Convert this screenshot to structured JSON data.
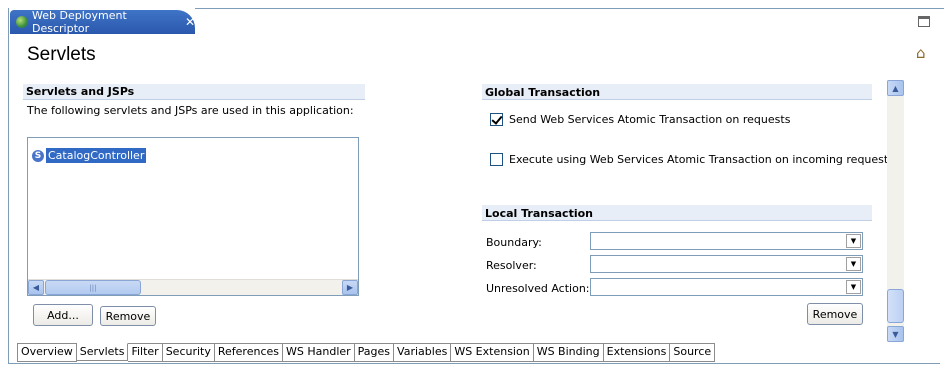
{
  "editor": {
    "tab_title": "Web Deployment Descriptor",
    "close_glyph": "✕",
    "page_title": "Servlets",
    "home_icon": "⌂"
  },
  "servlets_section": {
    "header": "Servlets and JSPs",
    "description": "The following servlets and JSPs are used in this application:",
    "items": [
      {
        "icon": "S",
        "label": "CatalogController",
        "selected": true
      }
    ],
    "scroll_left": "◀",
    "scroll_right": "▶",
    "thumb_grip": "|||",
    "add_button": "Add...",
    "remove_button": "Remove"
  },
  "global_transaction": {
    "header": "Global Transaction",
    "options": [
      {
        "label": "Send Web Services Atomic Transaction on requests",
        "checked": true
      },
      {
        "label": "Execute using Web Services Atomic Transaction on incoming requests",
        "checked": false
      }
    ]
  },
  "local_transaction": {
    "header": "Local Transaction",
    "fields": [
      {
        "label": "Boundary:",
        "value": ""
      },
      {
        "label": "Resolver:",
        "value": ""
      },
      {
        "label": "Unresolved Action:",
        "value": ""
      }
    ],
    "dropdown_glyph": "▼",
    "remove_button": "Remove"
  },
  "vscroll": {
    "up": "▲",
    "down": "▼"
  },
  "page_tabs": [
    "Overview",
    "Servlets",
    "Filter",
    "Security",
    "References",
    "WS Handler",
    "Pages",
    "Variables",
    "WS Extension",
    "WS Binding",
    "Extensions",
    "Source"
  ],
  "active_page_tab": "Servlets",
  "colors": {
    "tab_blue": "#2a58ac",
    "section_header_bg": "#e8eef7",
    "selection": "#316ac5"
  }
}
